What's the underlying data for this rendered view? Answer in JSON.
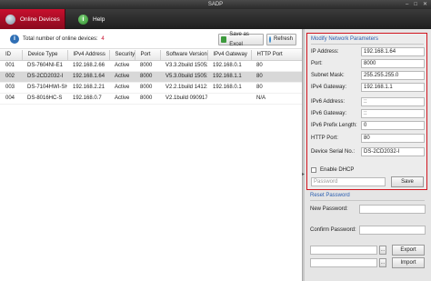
{
  "window": {
    "title": "SADP",
    "minimize": "–",
    "maximize": "□",
    "close": "✕"
  },
  "tabs": [
    {
      "label": "Online Devices",
      "icon": "network-device-icon"
    },
    {
      "label": "Help",
      "icon": "help-icon",
      "glyph": "i"
    }
  ],
  "toolbar": {
    "info_glyph": "i",
    "total_label": "Total number of online devices:",
    "total_count": "4",
    "save_excel_label": "Save as Excel",
    "refresh_label": "Refresh"
  },
  "table": {
    "columns": [
      "ID",
      "Device Type",
      "IPv4 Address",
      "Security",
      "Port",
      "Software Version",
      "IPv4 Gateway",
      "HTTP Port"
    ],
    "rows": [
      [
        "001",
        "DS-7604NI-E1",
        "192.168.2.66",
        "Active",
        "8000",
        "V3.3.2build 150522",
        "192.168.0.1",
        "80"
      ],
      [
        "002",
        "DS-2CD2032-I",
        "192.168.1.64",
        "Active",
        "8000",
        "V5.3.0build 150513",
        "192.168.1.1",
        "80"
      ],
      [
        "003",
        "DS-7104HWI-SH",
        "192.168.2.21",
        "Active",
        "8000",
        "V2.2.1build 141210",
        "192.168.0.1",
        "80"
      ],
      [
        "004",
        "DS-8016HC-S",
        "192.168.0.7",
        "Active",
        "8000",
        "V2.1build 090917",
        "",
        "N/A"
      ]
    ],
    "selected_row": 1
  },
  "modify": {
    "title": "Modify Network Parameters",
    "fields": [
      {
        "label": "IP Address:",
        "value": "192.168.1.64"
      },
      {
        "label": "Port:",
        "value": "8000"
      },
      {
        "label": "Subnet Mask:",
        "value": "255.255.255.0"
      },
      {
        "label": "IPv4 Gateway:",
        "value": "192.168.1.1"
      },
      {
        "label": "IPv6 Address:",
        "value": "::"
      },
      {
        "label": "IPv6 Gateway:",
        "value": "::"
      },
      {
        "label": "IPv6 Prefix Length:",
        "value": "0"
      },
      {
        "label": "HTTP Port:",
        "value": "80"
      },
      {
        "label": "Device Serial No.:",
        "value": "DS-2CD2032-I"
      }
    ],
    "dhcp_label": "Enable DHCP",
    "password_placeholder": "Password",
    "save_label": "Save"
  },
  "reset": {
    "title": "Reset Password",
    "new_password_label": "New Password:",
    "confirm_password_label": "Confirm Password:",
    "browse_label": "...",
    "export_label": "Export",
    "import_label": "Import"
  },
  "colors": {
    "accent_red": "#c8102e",
    "link_blue": "#2a5db0",
    "highlight_border": "#d2151f"
  }
}
